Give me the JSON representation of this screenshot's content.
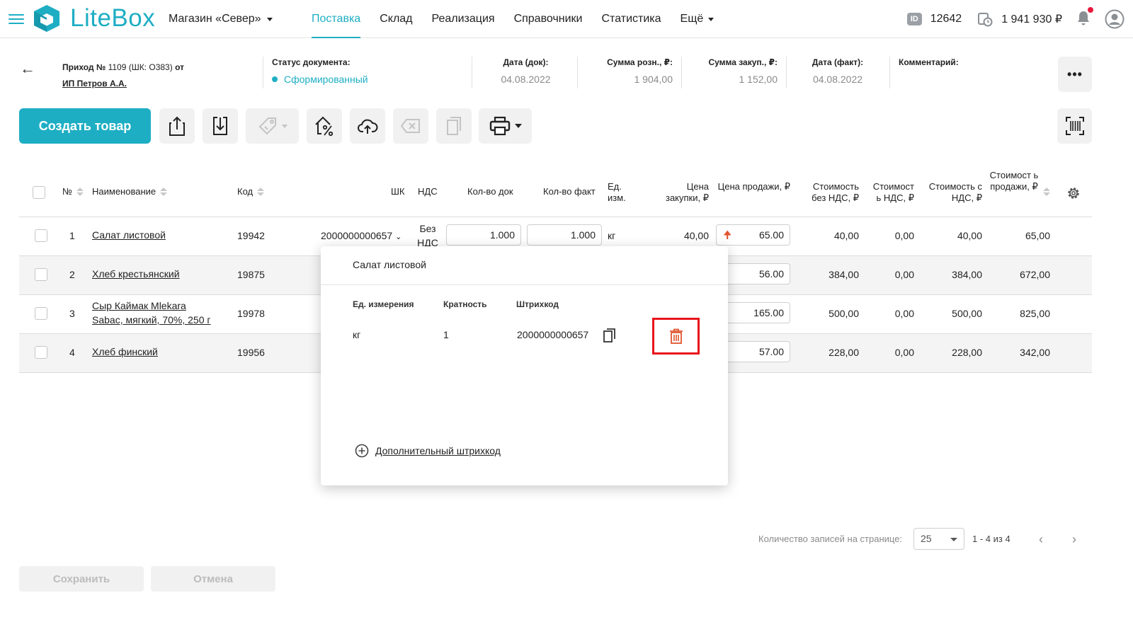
{
  "header": {
    "brand": "LiteBox",
    "store": "Магазин «Север»",
    "nav": [
      "Поставка",
      "Склад",
      "Реализация",
      "Справочники",
      "Статистика",
      "Ещё"
    ],
    "id_badge": "ID",
    "account_id": "12642",
    "balance": "1 941 930 ₽",
    "colors": {
      "accent": "#1eaec4",
      "notification": "#e8193c"
    }
  },
  "document": {
    "title_prefix": "Приход №",
    "number": "1109 (ШК: О383)",
    "title_suffix": "от",
    "supplier": "ИП Петров А.А.",
    "status_label": "Статус документа:",
    "status_value": "Сформированный",
    "date_doc_label": "Дата (док):",
    "date_doc": "04.08.2022",
    "retail_sum_label": "Сумма розн., ₽:",
    "retail_sum": "1 904,00",
    "purchase_sum_label": "Сумма закуп., ₽:",
    "purchase_sum": "1 152,00",
    "date_fact_label": "Дата (факт):",
    "date_fact": "04.08.2022",
    "comment_label": "Комментарий:",
    "more": "•••"
  },
  "toolbar": {
    "create_label": "Создать товар",
    "icons": [
      "export-icon",
      "import-icon",
      "price-tag-icon",
      "markup-percent-icon",
      "upload-cloud-icon",
      "clear-icon",
      "copy-icon",
      "print-icon",
      "barcode-scan-icon"
    ]
  },
  "table": {
    "headers": {
      "num": "№",
      "name": "Наименование",
      "code": "Код",
      "barcode": "ШК",
      "vat": "НДС",
      "qty_doc": "Кол-во док",
      "qty_fact": "Кол-во факт",
      "unit": "Ед. изм.",
      "purchase_price": "Цена закупки, ₽",
      "sale_price": "Цена продажи, ₽",
      "cost_no_vat": "Стоимость без НДС, ₽",
      "vat_cost": "Стоимост ь НДС, ₽",
      "cost_with_vat": "Стоимость с НДС, ₽",
      "sale_cost": "Стоимост ь продажи, ₽"
    },
    "rows": [
      {
        "num": "1",
        "name": "Салат листовой",
        "code": "19942",
        "barcode": "2000000000657",
        "vat": "Без НДС",
        "qty_doc": "1.000",
        "qty_fact": "1.000",
        "unit": "кг",
        "purchase_price": "40,00",
        "sale_price": "65.00",
        "cost_no_vat": "40,00",
        "vat_cost": "0,00",
        "cost_with_vat": "40,00",
        "sale_cost": "65,00"
      },
      {
        "num": "2",
        "name": "Хлеб крестьянский",
        "code": "19875",
        "sale_price": "56.00",
        "cost_no_vat": "384,00",
        "vat_cost": "0,00",
        "cost_with_vat": "384,00",
        "sale_cost": "672,00"
      },
      {
        "num": "3",
        "name_line1": "Сыр Каймак Mlekara",
        "name_line2": "Sabac, мягкий, 70%, 250 г",
        "code": "19978",
        "sale_price": "165.00",
        "cost_no_vat": "500,00",
        "vat_cost": "0,00",
        "cost_with_vat": "500,00",
        "sale_cost": "825,00"
      },
      {
        "num": "4",
        "name": "Хлеб финский",
        "code": "19956",
        "sale_price": "57.00",
        "cost_no_vat": "228,00",
        "vat_cost": "0,00",
        "cost_with_vat": "228,00",
        "sale_cost": "342,00"
      }
    ]
  },
  "popup": {
    "title": "Салат листовой",
    "col_unit": "Ед. измерения",
    "col_multiplicity": "Кратность",
    "col_barcode": "Штрихкод",
    "unit": "кг",
    "multiplicity": "1",
    "barcode": "2000000000657",
    "add_barcode": "Дополнительный штрихкод",
    "delete_color": "#e8141c"
  },
  "pagination": {
    "per_page_label": "Количество записей на странице:",
    "per_page": "25",
    "range": "1 - 4 из 4"
  },
  "footer": {
    "save": "Сохранить",
    "cancel": "Отмена"
  }
}
